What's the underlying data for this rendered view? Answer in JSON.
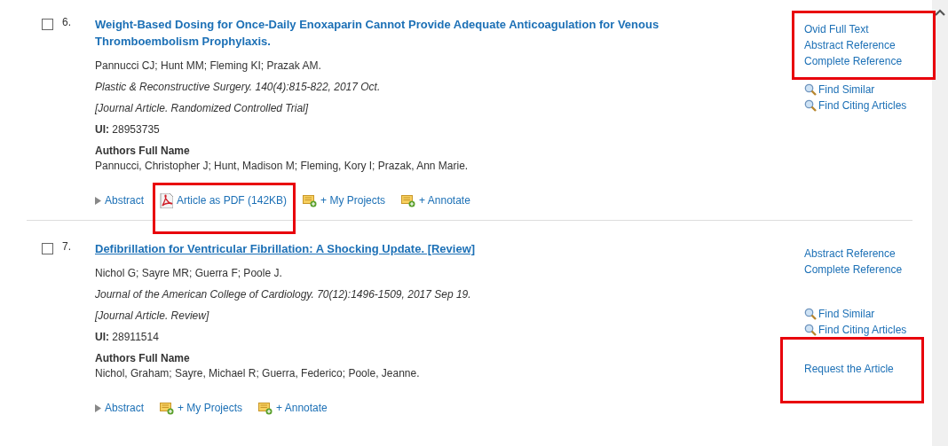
{
  "records": [
    {
      "number": "6.",
      "checked": false,
      "title": "Weight-Based Dosing for Once-Daily Enoxaparin Cannot Provide Adequate Anticoagulation for Venous Thromboembolism Prophylaxis.",
      "title_underlined": false,
      "authors": "Pannucci CJ; Hunt MM; Fleming KI; Prazak AM.",
      "source": "Plastic & Reconstructive Surgery. 140(4):815-822, 2017 Oct.",
      "pub_type": "[Journal Article. Randomized Controlled Trial]",
      "ui_label": "UI:",
      "ui": "28953735",
      "full_names_label": "Authors Full Name",
      "full_names": "Pannucci, Christopher J; Hunt, Madison M; Fleming, Kory I; Prazak, Ann Marie.",
      "actions": [
        {
          "kind": "abstract",
          "label": "Abstract",
          "highlighted": false
        },
        {
          "kind": "pdf",
          "label": "Article as PDF (142KB)",
          "highlighted": true
        },
        {
          "kind": "projects",
          "label": "+ My Projects",
          "highlighted": false
        },
        {
          "kind": "annotate",
          "label": "+ Annotate",
          "highlighted": false
        }
      ],
      "links": [
        "Ovid Full Text",
        "Abstract Reference",
        "Complete Reference"
      ],
      "links_highlighted": true,
      "tools": [
        "Find Similar",
        "Find Citing Articles"
      ]
    },
    {
      "number": "7.",
      "checked": false,
      "title": "Defibrillation for Ventricular Fibrillation: A Shocking Update. [Review]",
      "title_underlined": true,
      "authors": "Nichol G; Sayre MR; Guerra F; Poole J.",
      "source": "Journal of the American College of Cardiology. 70(12):1496-1509, 2017 Sep 19.",
      "pub_type": "[Journal Article. Review]",
      "ui_label": "UI:",
      "ui": "28911514",
      "full_names_label": "Authors Full Name",
      "full_names": "Nichol, Graham; Sayre, Michael R; Guerra, Federico; Poole, Jeanne.",
      "actions": [
        {
          "kind": "abstract",
          "label": "Abstract",
          "highlighted": false
        },
        {
          "kind": "projects",
          "label": "+ My Projects",
          "highlighted": false
        },
        {
          "kind": "annotate",
          "label": "+ Annotate",
          "highlighted": false
        }
      ],
      "links": [
        "Abstract Reference",
        "Complete Reference"
      ],
      "links_highlighted": false,
      "tools": [
        "Find Similar",
        "Find Citing Articles"
      ],
      "request": {
        "label": "Request the Article",
        "highlighted": true
      }
    }
  ]
}
